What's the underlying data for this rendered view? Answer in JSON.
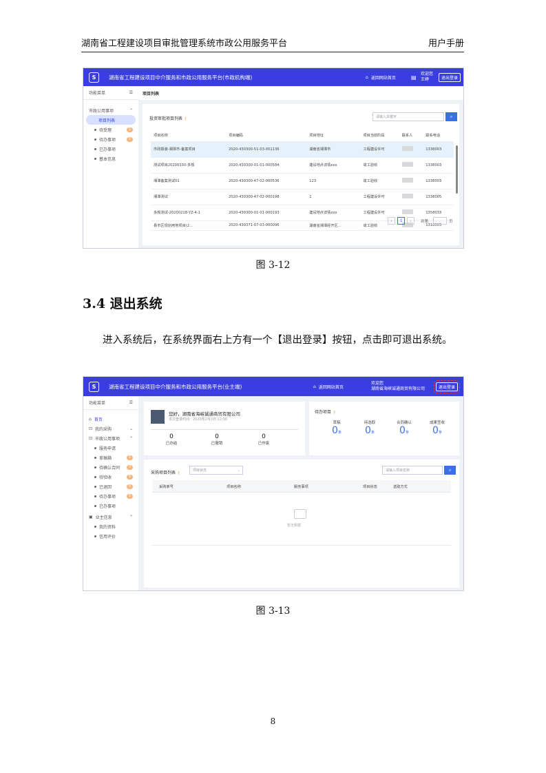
{
  "header": {
    "left": "湖南省工程建设项目审批管理系统市政公用服务平台",
    "right": "用户手册"
  },
  "fig1": {
    "title": "湖南省工程建设项目中介服务和市政公用服务平台(市政机构端)",
    "home": "返回网站首页",
    "welcome_line1": "欢迎您",
    "welcome_line2": "王婷",
    "logout": "退出登录",
    "sidebar": {
      "head": "功能菜单",
      "group": "市政公用事项",
      "items": [
        {
          "label": "项目列表",
          "badge": ""
        },
        {
          "label": "待受理",
          "badge": "1"
        },
        {
          "label": "待办事项",
          "badge": "2"
        },
        {
          "label": "已办事项",
          "badge": ""
        },
        {
          "label": "基本信息",
          "badge": ""
        }
      ]
    },
    "tab": "项目列表",
    "list_title": "投资审批项目列表",
    "search_placeholder": "请输入关键字",
    "columns": [
      "项目名称",
      "项目编码",
      "项目地址",
      "项目当前阶段",
      "联系人",
      "联系电话"
    ],
    "rows": [
      [
        "市政报装-湘潭市-备案项目",
        "2020-430300-51-03-001136",
        "湖南省湘潭市",
        "工程建设许可",
        "",
        "1338003"
      ],
      [
        "测试项目20200330-多规",
        "2020-430300-01-01-000584",
        "建设地点详情xxx",
        "竣工验收",
        "",
        "1338003"
      ],
      [
        "湘潭备案测试01",
        "2020-430300-47-02-000536",
        "123",
        "竣工验收",
        "",
        "1338003"
      ],
      [
        "湘潭测试",
        "2020-430300-47-02-000198",
        "1",
        "工程建设许可",
        "",
        "1338005"
      ],
      [
        "多规测试-20200218-YZ-4-1",
        "2020-430300-01-01-000193",
        "建设地点详情xxx",
        "工程建设许可",
        "",
        "1358033"
      ],
      [
        "县市区规划用地项目(2...",
        "2020-430371-07-03-000096",
        "湖南省湘潭经开区...",
        "竣工验收",
        "",
        "1318003"
      ]
    ],
    "pager": {
      "page": "1",
      "goto": "到第",
      "unit": "页"
    }
  },
  "caption1": "图 3-12",
  "section": "3.4  退出系统",
  "paragraph": "进入系统后，在系统界面右上方有一个【退出登录】按钮，点击即可退出系统。",
  "fig2": {
    "title": "湖南省工程建设项目中介服务和市政公用服务平台(业主端)",
    "home": "返回网站首页",
    "welcome_line1": "欢迎您",
    "welcome_line2": "湖南省海峡诚通商贸有限公司",
    "logout": "退出登录",
    "sidebar": {
      "head": "功能菜单",
      "items": [
        {
          "label": "首页",
          "kind": "top",
          "badge": ""
        },
        {
          "label": "我的采购",
          "kind": "top",
          "badge": ""
        },
        {
          "label": "市政公用事项",
          "kind": "top",
          "badge": ""
        },
        {
          "label": "服务申请",
          "kind": "sub",
          "badge": ""
        },
        {
          "label": "草稿箱",
          "kind": "sub",
          "badge": "0"
        },
        {
          "label": "待确认合同",
          "kind": "sub",
          "badge": "0"
        },
        {
          "label": "待验收",
          "kind": "sub",
          "badge": "0"
        },
        {
          "label": "已退回",
          "kind": "sub",
          "badge": "0"
        },
        {
          "label": "待办事项",
          "kind": "sub",
          "badge": "0"
        },
        {
          "label": "已办事项",
          "kind": "sub",
          "badge": ""
        },
        {
          "label": "业主信息",
          "kind": "top",
          "badge": ""
        },
        {
          "label": "我的资料",
          "kind": "sub",
          "badge": ""
        },
        {
          "label": "信用评价",
          "kind": "sub",
          "badge": ""
        }
      ]
    },
    "company": {
      "greeting": "您好，湖南省海峡诚通商贸有限公司",
      "login_time": "本次登录时间：2020年2月3日 12:16"
    },
    "stats": [
      {
        "n": "0",
        "label": "已办结"
      },
      {
        "n": "0",
        "label": "已撤销"
      },
      {
        "n": "0",
        "label": "已作废"
      }
    ],
    "todo": {
      "title": "待办项目",
      "items": [
        {
          "label": "草稿",
          "n": "0"
        },
        {
          "label": "待选取",
          "n": "0"
        },
        {
          "label": "合同确认",
          "n": "0"
        },
        {
          "label": "成果签收",
          "n": "0"
        }
      ],
      "unit": "条"
    },
    "list_title": "采购项目列表",
    "status_placeholder": "项目状态",
    "search_placeholder": "请输入项目名称",
    "columns": [
      "采购单号",
      "项目名称",
      "服务事项",
      "项目状态",
      "选取方式"
    ],
    "empty": "暂无数据"
  },
  "caption2": "图 3-13",
  "page_number": "8"
}
